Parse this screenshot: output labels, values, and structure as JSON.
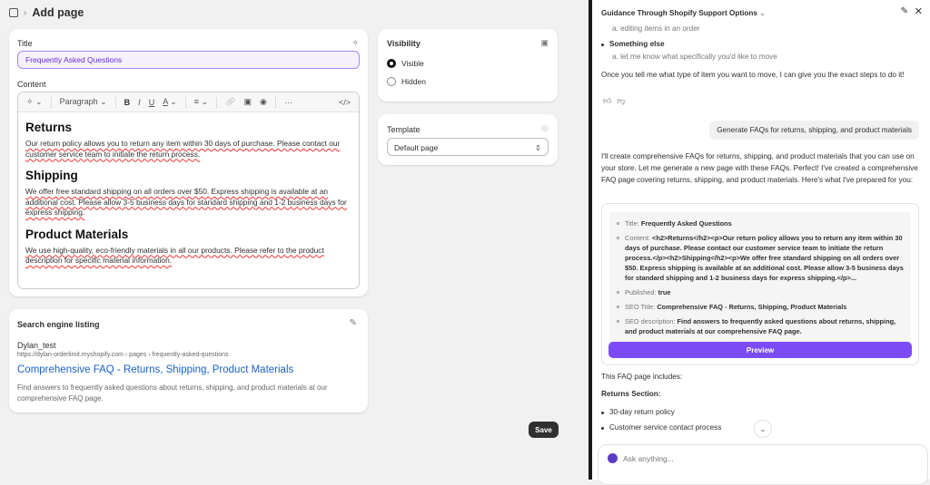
{
  "header": {
    "title": "Add page",
    "breadcrumb_icon": "pages-icon",
    "chevron": "›"
  },
  "title_card": {
    "label": "Title",
    "value": "Frequently Asked Questions",
    "content_label": "Content",
    "toolbar": {
      "paragraph": "Paragraph",
      "bold": "B",
      "italic": "I",
      "underline": "U",
      "color": "A",
      "more": "···",
      "code": "</>"
    },
    "content": [
      {
        "heading": "Returns",
        "text": "Our return policy allows you to return any item within 30 days of purchase. Please contact our customer service team to initiate the return process."
      },
      {
        "heading": "Shipping",
        "text": "We offer free standard shipping on all orders over $50. Express shipping is available at an additional cost. Please allow 3-5 business days for standard shipping and 1-2 business days for express shipping."
      },
      {
        "heading": "Product Materials",
        "text": "We use high-quality, eco-friendly materials in all our products. Please refer to the product description for specific material information."
      }
    ]
  },
  "seo": {
    "label": "Search engine listing",
    "store": "Dylan_test",
    "url": "https://dylan-orderlimit.myshopify.com › pages › frequently-asked-questions",
    "title": "Comprehensive FAQ - Returns, Shipping, Product Materials",
    "description": "Find answers to frequently asked questions about returns, shipping, and product materials at our comprehensive FAQ page."
  },
  "visibility": {
    "label": "Visibility",
    "options": [
      "Visible",
      "Hidden"
    ],
    "selected": "Visible"
  },
  "template": {
    "label": "Template",
    "value": "Default page"
  },
  "save_label": "Save",
  "chat": {
    "title": "Guidance Through Shopify Support Options",
    "prev_item": "a. editing items in an order",
    "bullet": "Something else",
    "bullet_sub": "a. let me know what specifically you'd like to move",
    "followup": "Once you tell me what type of item you want to move, I can give you the exact steps to do it!",
    "user_msg": "Generate FAQs for returns, shipping, and product materials",
    "reply": "I'll create comprehensive FAQs for returns, shipping, and product materials that you can use on your store. Let me generate a new page with these FAQs. Perfect! I've created a comprehensive FAQ page covering returns, shipping, and product materials. Here's what I've prepared for you:",
    "summary": [
      {
        "k": "Title:",
        "v": "Frequently Asked Questions"
      },
      {
        "k": "Content:",
        "v": "<h2>Returns</h2><p>Our return policy allows you to return any item within 30 days of purchase. Please contact our customer service team to initiate the return process.</p><h2>Shipping</h2><p>We offer free standard shipping on all orders over $50. Express shipping is available at an additional cost. Please allow 3-5 business days for standard shipping and 1-2 business days for express shipping.</p>..."
      },
      {
        "k": "Published:",
        "v": "true"
      },
      {
        "k": "SEO Title:",
        "v": "Comprehensive FAQ - Returns, Shipping, Product Materials"
      },
      {
        "k": "SEO description:",
        "v": "Find answers to frequently asked questions about returns, shipping, and product materials at our comprehensive FAQ page."
      }
    ],
    "preview_label": "Preview",
    "includes": "This FAQ page includes:",
    "section": "Returns Section:",
    "section_items": [
      "30-day return policy",
      "Customer service contact process"
    ],
    "input_placeholder": "Ask anything...",
    "accent": "#7b4cf5"
  }
}
